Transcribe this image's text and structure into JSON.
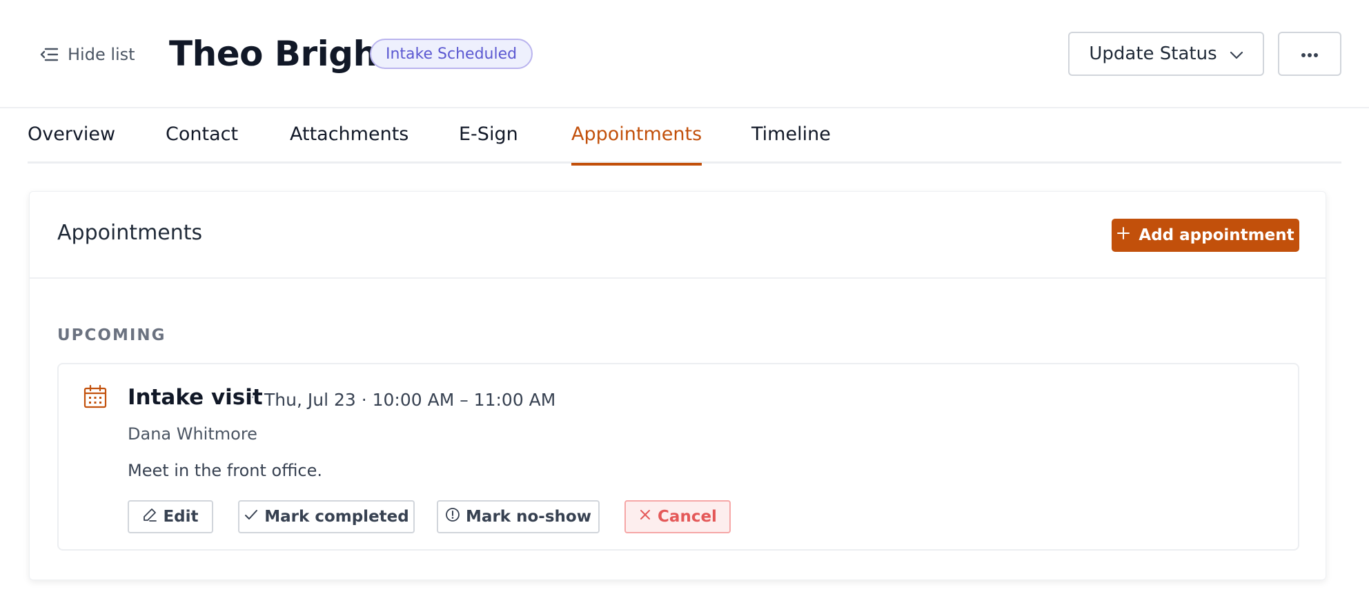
{
  "header": {
    "hide_list_label": "Hide list",
    "title": "Theo Bright",
    "status_badge": "Intake Scheduled",
    "update_status_label": "Update Status"
  },
  "tabs": [
    {
      "label": "Overview",
      "active": false
    },
    {
      "label": "Contact",
      "active": false
    },
    {
      "label": "Attachments",
      "active": false
    },
    {
      "label": "E-Sign",
      "active": false
    },
    {
      "label": "Appointments",
      "active": true
    },
    {
      "label": "Timeline",
      "active": false
    }
  ],
  "appointments_card": {
    "title": "Appointments",
    "add_label": "Add appointment",
    "section_label": "UPCOMING",
    "items": [
      {
        "name": "Intake visit",
        "separator": "·",
        "time": "Thu, Jul 23 · 10:00 AM – 11:00 AM",
        "person": "Dana Whitmore",
        "note": "Meet in the front office.",
        "actions": {
          "edit": "Edit",
          "complete": "Mark completed",
          "no_show": "Mark no-show",
          "cancel": "Cancel"
        }
      }
    ]
  },
  "colors": {
    "accent": "#c2500b",
    "badge_bg": "#eef0fd",
    "badge_text": "#5b58d1",
    "cancel_text": "#e45858"
  },
  "icons": {
    "hide_list": "list-collapse-icon",
    "update_status": "chevron-down-icon",
    "more": "more-horizontal-icon",
    "add": "plus-icon",
    "appointment": "calendar-icon",
    "edit": "pencil-icon",
    "complete": "check-icon",
    "no_show": "alert-circle-icon",
    "cancel": "close-icon"
  }
}
